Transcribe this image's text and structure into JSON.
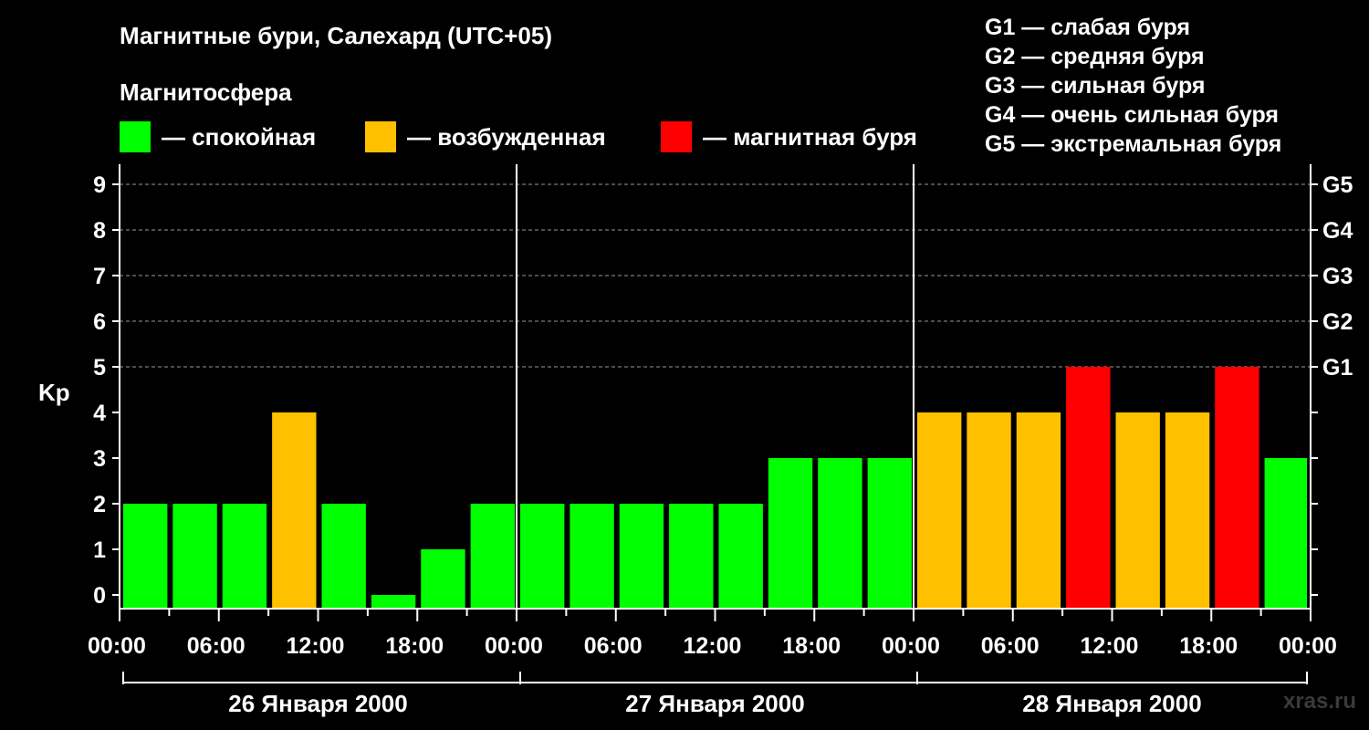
{
  "title": "Магнитные бури, Салехард (UTC+05)",
  "subtitle": "Магнитосфера",
  "legend": [
    {
      "label": "— спокойная",
      "color": "#00ff00"
    },
    {
      "label": "— возбужденная",
      "color": "#ffc000"
    },
    {
      "label": "— магнитная буря",
      "color": "#ff0000"
    }
  ],
  "g_scale_legend": [
    "G1 — слабая буря",
    "G2 — средняя буря",
    "G3 — сильная буря",
    "G4 — очень сильная буря",
    "G5 — экстремальная буря"
  ],
  "watermark": "xras.ru",
  "chart_data": {
    "type": "bar",
    "ylabel": "Kp",
    "ylim": [
      0,
      9
    ],
    "yticks": [
      "0",
      "1",
      "2",
      "3",
      "4",
      "5",
      "6",
      "7",
      "8",
      "9"
    ],
    "right_ticks": [
      {
        "value": 5,
        "label": "G1"
      },
      {
        "value": 6,
        "label": "G2"
      },
      {
        "value": 7,
        "label": "G3"
      },
      {
        "value": 8,
        "label": "G4"
      },
      {
        "value": 9,
        "label": "G5"
      }
    ],
    "xtick_labels": [
      "00:00",
      "06:00",
      "12:00",
      "18:00",
      "00:00",
      "06:00",
      "12:00",
      "18:00",
      "00:00",
      "06:00",
      "12:00",
      "18:00",
      "00:00"
    ],
    "days": [
      "26 Января 2000",
      "27 Января 2000",
      "28 Января 2000"
    ],
    "interval_hours": 3,
    "values": [
      2,
      2,
      2,
      4,
      2,
      0,
      1,
      2,
      2,
      2,
      2,
      2,
      2,
      3,
      3,
      3,
      4,
      4,
      4,
      5,
      4,
      4,
      5,
      3
    ],
    "colors": [
      "#00ff00",
      "#00ff00",
      "#00ff00",
      "#ffc000",
      "#00ff00",
      "#00ff00",
      "#00ff00",
      "#00ff00",
      "#00ff00",
      "#00ff00",
      "#00ff00",
      "#00ff00",
      "#00ff00",
      "#00ff00",
      "#00ff00",
      "#00ff00",
      "#ffc000",
      "#ffc000",
      "#ffc000",
      "#ff0000",
      "#ffc000",
      "#ffc000",
      "#ff0000",
      "#00ff00"
    ],
    "grid": "dashed horizontal at each Kp level from 5 to 9"
  }
}
